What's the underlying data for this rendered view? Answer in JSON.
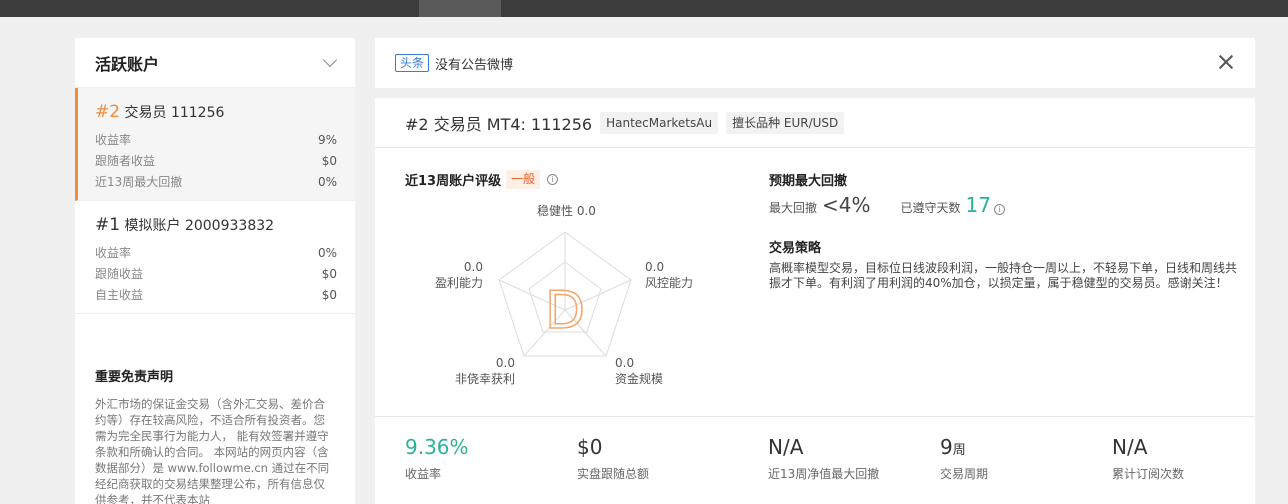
{
  "sidebar": {
    "title": "活跃账户",
    "accounts": [
      {
        "rank": "#2",
        "name": "交易员 111256",
        "rows": [
          {
            "label": "收益率",
            "value": "9%"
          },
          {
            "label": "跟随者收益",
            "value": "$0"
          },
          {
            "label": "近13周最大回撤",
            "value": "0%"
          }
        ]
      },
      {
        "rank": "#1",
        "name": "模拟账户 2000933832",
        "rows": [
          {
            "label": "收益率",
            "value": "0%"
          },
          {
            "label": "跟随收益",
            "value": "$0"
          },
          {
            "label": "自主收益",
            "value": "$0"
          }
        ]
      }
    ],
    "disclaimer": {
      "title": "重要免责声明",
      "body": "外汇市场的保证金交易（含外汇交易、差价合约等）存在较高风险，不适合所有投资者。您需为完全民事行为能力人， 能有效签署并遵守条款和所确认的合同。 本网站的网页内容（含数据部分）是 www.followme.cn 通过在不同经纪商获取的交易结果整理公布，所有信息仅供参考，并不代表本站"
    }
  },
  "notice": {
    "badge": "头条",
    "text": "没有公告微博"
  },
  "trader": {
    "rank": "#2",
    "title": "交易员  MT4: 111256",
    "broker_tag": "HantecMarketsAu",
    "symbol_tag": "擅长品种 EUR/USD"
  },
  "rating": {
    "label": "近13周账户评级",
    "badge": "一般",
    "grade": "D",
    "axes": [
      {
        "name": "稳健性",
        "value": "0.0"
      },
      {
        "name": "风控能力",
        "value": "0.0"
      },
      {
        "name": "资金规模",
        "value": "0.0"
      },
      {
        "name": "非侥幸获利",
        "value": "0.0"
      },
      {
        "name": "盈利能力",
        "value": "0.0"
      }
    ]
  },
  "drawdown": {
    "title": "预期最大回撤",
    "max_label": "最大回撤",
    "max_value": "<4%",
    "days_label": "已遵守天数",
    "days_value": "17"
  },
  "strategy": {
    "title": "交易策略",
    "text": "高概率模型交易，目标位日线波段利润，一般持仓一周以上，不轻易下单，日线和周线共振才下单。有利润了用利润的40%加仓，以损定量，属于稳健型的交易员。感谢关注！"
  },
  "stats": [
    {
      "value": "9.36%",
      "unit": "",
      "label": "收益率"
    },
    {
      "value": "$0",
      "unit": "",
      "label": "实盘跟随总额"
    },
    {
      "value": "N/A",
      "unit": "",
      "label": "近13周净值最大回撤"
    },
    {
      "value": "9",
      "unit": "周",
      "label": "交易周期"
    },
    {
      "value": "N/A",
      "unit": "",
      "label": "累计订阅次数"
    }
  ],
  "colors": {
    "accent_orange": "#f08c3c",
    "green": "#2bb39a",
    "notice_blue": "#3a7bd5"
  }
}
